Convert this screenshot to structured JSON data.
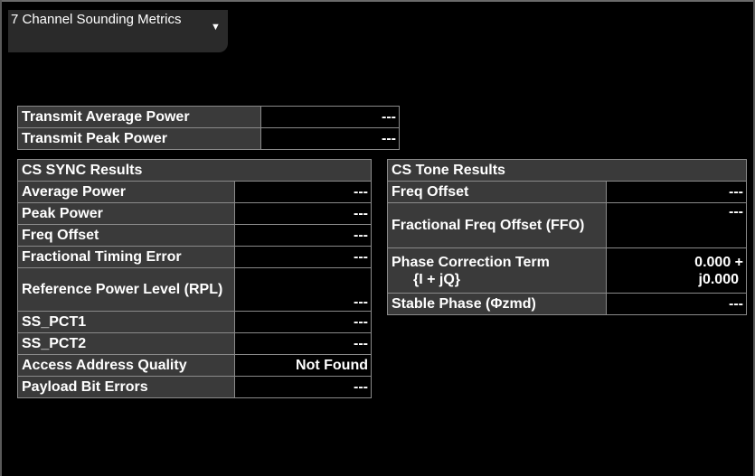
{
  "window": {
    "title": "7 Channel Sounding Metrics",
    "dropdown_icon": "triangle-down-icon"
  },
  "power": {
    "rows": [
      {
        "label": "Transmit Average Power",
        "value": "---"
      },
      {
        "label": "Transmit Peak Power",
        "value": "---"
      }
    ]
  },
  "cs_sync": {
    "title": "CS SYNC Results",
    "rows": [
      {
        "label": "Average Power",
        "value": "---"
      },
      {
        "label": "Peak Power",
        "value": "---"
      },
      {
        "label": "Freq Offset",
        "value": "---"
      },
      {
        "label": "Fractional Timing Error",
        "value": "---"
      },
      {
        "label": "Reference Power Level (RPL)",
        "value": "---"
      },
      {
        "label": "SS_PCT1",
        "value": "---"
      },
      {
        "label": "SS_PCT2",
        "value": "---"
      },
      {
        "label": "Access Address Quality",
        "value": "Not Found"
      },
      {
        "label": "Payload Bit Errors",
        "value": "---"
      }
    ]
  },
  "cs_tone": {
    "title": "CS Tone Results",
    "rows": [
      {
        "label": "Freq Offset",
        "value": "---"
      },
      {
        "label": "Fractional Freq Offset (FFO)",
        "value": "---"
      },
      {
        "label": "Phase Correction Term",
        "label_line2": "{I + jQ}",
        "value": "0.000 +",
        "value_line2": "j0.000"
      },
      {
        "label": "Stable Phase (Φzmd)",
        "value": "---"
      }
    ]
  },
  "colors": {
    "background": "#000000",
    "label_cell": "#3a3a3a",
    "border": "#8a8a8a",
    "text": "#ffffff"
  }
}
